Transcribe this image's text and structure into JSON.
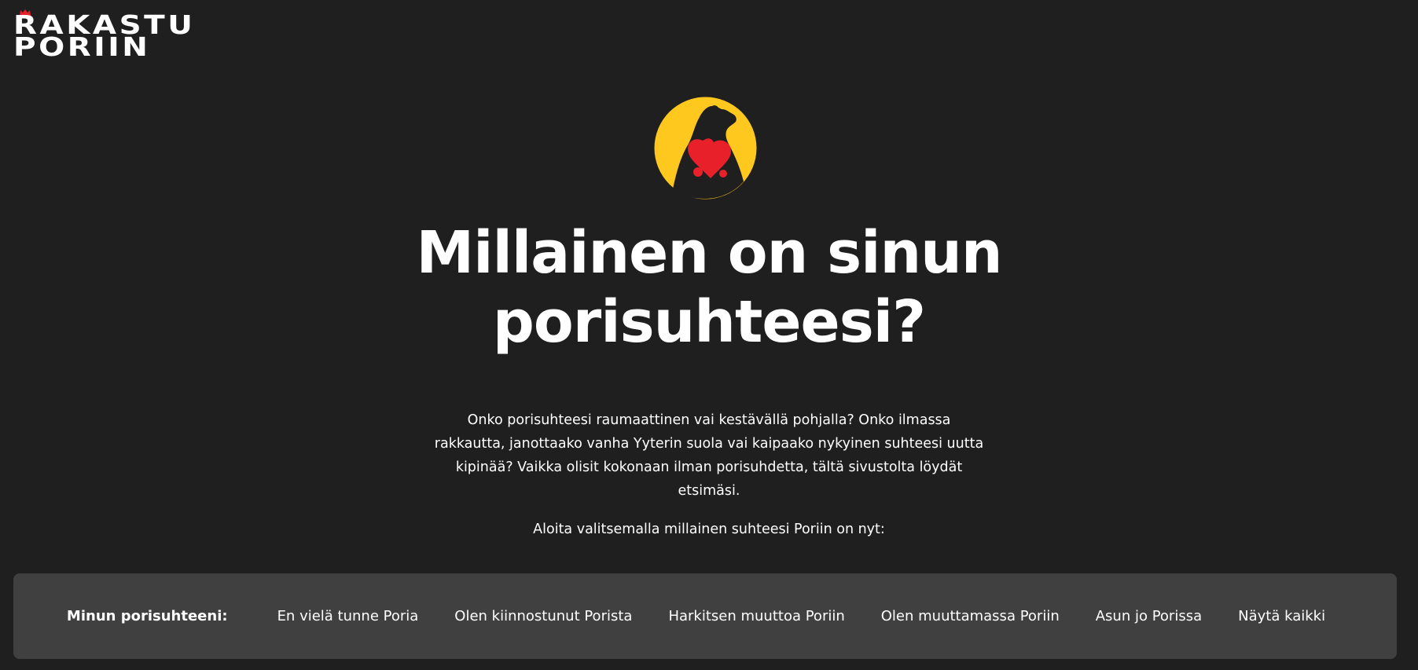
{
  "brand": {
    "logo_line1": "RAKASTU",
    "logo_line2": "PORIIN",
    "crown_color": "#e8202a"
  },
  "hero": {
    "emblem_icon": "bear-with-heart-icon",
    "emblem_circle_color": "#ffc81e",
    "emblem_heart_color": "#e8202a",
    "title_line1": "Millainen on sinun",
    "title_line2": "porisuhteesi?",
    "intro_line1": "Onko porisuhteesi raumaattinen vai kestävällä pohjalla? Onko ilmassa",
    "intro_line2": "rakkautta, janottaako vanha Yyterin suola vai kaipaako nykyinen suhteesi uutta",
    "intro_line3": "kipinää? Vaikka olisit kokonaan ilman porisuhdetta, tältä sivustolta löydät",
    "intro_line4": "etsimäsi.",
    "prompt": "Aloita valitsemalla millainen suhteesi Poriin on nyt:"
  },
  "filter": {
    "label": "Minun porisuhteeni:",
    "options": [
      "En vielä tunne Poria",
      "Olen kiinnostunut Porista",
      "Harkitsen muuttoa Poriin",
      "Olen muuttamassa Poriin",
      "Asun jo Porissa",
      "Näytä kaikki"
    ],
    "bar_color": "#404040"
  },
  "colors": {
    "background": "#1f1f1f",
    "text": "#ffffff"
  }
}
